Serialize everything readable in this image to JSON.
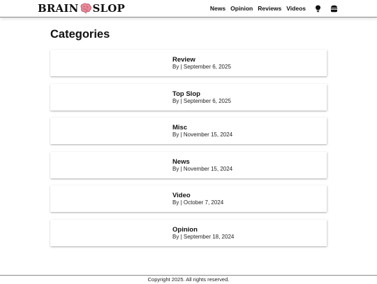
{
  "header": {
    "logo": {
      "left_text": "BRAIN",
      "right_text": "SLOP",
      "icon": "brain-icon"
    },
    "nav": [
      {
        "label": "News"
      },
      {
        "label": "Opinion"
      },
      {
        "label": "Reviews"
      },
      {
        "label": "Videos"
      }
    ],
    "icons": [
      "lightbulb-icon",
      "burger-icon"
    ]
  },
  "main": {
    "title": "Categories",
    "categories": [
      {
        "title": "Review",
        "meta": "By | September 6, 2025"
      },
      {
        "title": "Top Slop",
        "meta": "By | September 6, 2025"
      },
      {
        "title": "Misc",
        "meta": "By | November 15, 2024"
      },
      {
        "title": "News",
        "meta": "By | November 15, 2024"
      },
      {
        "title": "Video",
        "meta": "By | October 7, 2024"
      },
      {
        "title": "Opinion",
        "meta": "By | September 18, 2024"
      }
    ]
  },
  "footer": {
    "copyright": "Copyright 2025. All rights reserved."
  },
  "colors": {
    "brain_pink": "#e88a9a",
    "header_border": "#8a8a8a",
    "text": "#111111"
  }
}
